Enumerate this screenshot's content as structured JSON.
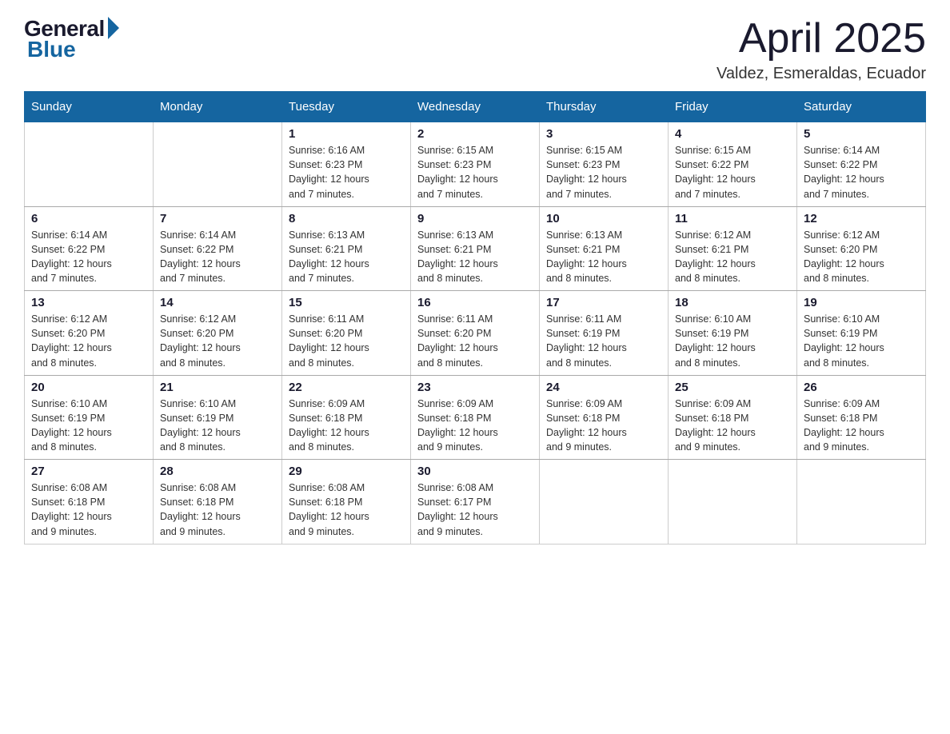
{
  "logo": {
    "general": "General",
    "blue": "Blue"
  },
  "title": "April 2025",
  "location": "Valdez, Esmeraldas, Ecuador",
  "days_header": [
    "Sunday",
    "Monday",
    "Tuesday",
    "Wednesday",
    "Thursday",
    "Friday",
    "Saturday"
  ],
  "weeks": [
    [
      {
        "day": "",
        "info": ""
      },
      {
        "day": "",
        "info": ""
      },
      {
        "day": "1",
        "info": "Sunrise: 6:16 AM\nSunset: 6:23 PM\nDaylight: 12 hours\nand 7 minutes."
      },
      {
        "day": "2",
        "info": "Sunrise: 6:15 AM\nSunset: 6:23 PM\nDaylight: 12 hours\nand 7 minutes."
      },
      {
        "day": "3",
        "info": "Sunrise: 6:15 AM\nSunset: 6:23 PM\nDaylight: 12 hours\nand 7 minutes."
      },
      {
        "day": "4",
        "info": "Sunrise: 6:15 AM\nSunset: 6:22 PM\nDaylight: 12 hours\nand 7 minutes."
      },
      {
        "day": "5",
        "info": "Sunrise: 6:14 AM\nSunset: 6:22 PM\nDaylight: 12 hours\nand 7 minutes."
      }
    ],
    [
      {
        "day": "6",
        "info": "Sunrise: 6:14 AM\nSunset: 6:22 PM\nDaylight: 12 hours\nand 7 minutes."
      },
      {
        "day": "7",
        "info": "Sunrise: 6:14 AM\nSunset: 6:22 PM\nDaylight: 12 hours\nand 7 minutes."
      },
      {
        "day": "8",
        "info": "Sunrise: 6:13 AM\nSunset: 6:21 PM\nDaylight: 12 hours\nand 7 minutes."
      },
      {
        "day": "9",
        "info": "Sunrise: 6:13 AM\nSunset: 6:21 PM\nDaylight: 12 hours\nand 8 minutes."
      },
      {
        "day": "10",
        "info": "Sunrise: 6:13 AM\nSunset: 6:21 PM\nDaylight: 12 hours\nand 8 minutes."
      },
      {
        "day": "11",
        "info": "Sunrise: 6:12 AM\nSunset: 6:21 PM\nDaylight: 12 hours\nand 8 minutes."
      },
      {
        "day": "12",
        "info": "Sunrise: 6:12 AM\nSunset: 6:20 PM\nDaylight: 12 hours\nand 8 minutes."
      }
    ],
    [
      {
        "day": "13",
        "info": "Sunrise: 6:12 AM\nSunset: 6:20 PM\nDaylight: 12 hours\nand 8 minutes."
      },
      {
        "day": "14",
        "info": "Sunrise: 6:12 AM\nSunset: 6:20 PM\nDaylight: 12 hours\nand 8 minutes."
      },
      {
        "day": "15",
        "info": "Sunrise: 6:11 AM\nSunset: 6:20 PM\nDaylight: 12 hours\nand 8 minutes."
      },
      {
        "day": "16",
        "info": "Sunrise: 6:11 AM\nSunset: 6:20 PM\nDaylight: 12 hours\nand 8 minutes."
      },
      {
        "day": "17",
        "info": "Sunrise: 6:11 AM\nSunset: 6:19 PM\nDaylight: 12 hours\nand 8 minutes."
      },
      {
        "day": "18",
        "info": "Sunrise: 6:10 AM\nSunset: 6:19 PM\nDaylight: 12 hours\nand 8 minutes."
      },
      {
        "day": "19",
        "info": "Sunrise: 6:10 AM\nSunset: 6:19 PM\nDaylight: 12 hours\nand 8 minutes."
      }
    ],
    [
      {
        "day": "20",
        "info": "Sunrise: 6:10 AM\nSunset: 6:19 PM\nDaylight: 12 hours\nand 8 minutes."
      },
      {
        "day": "21",
        "info": "Sunrise: 6:10 AM\nSunset: 6:19 PM\nDaylight: 12 hours\nand 8 minutes."
      },
      {
        "day": "22",
        "info": "Sunrise: 6:09 AM\nSunset: 6:18 PM\nDaylight: 12 hours\nand 8 minutes."
      },
      {
        "day": "23",
        "info": "Sunrise: 6:09 AM\nSunset: 6:18 PM\nDaylight: 12 hours\nand 9 minutes."
      },
      {
        "day": "24",
        "info": "Sunrise: 6:09 AM\nSunset: 6:18 PM\nDaylight: 12 hours\nand 9 minutes."
      },
      {
        "day": "25",
        "info": "Sunrise: 6:09 AM\nSunset: 6:18 PM\nDaylight: 12 hours\nand 9 minutes."
      },
      {
        "day": "26",
        "info": "Sunrise: 6:09 AM\nSunset: 6:18 PM\nDaylight: 12 hours\nand 9 minutes."
      }
    ],
    [
      {
        "day": "27",
        "info": "Sunrise: 6:08 AM\nSunset: 6:18 PM\nDaylight: 12 hours\nand 9 minutes."
      },
      {
        "day": "28",
        "info": "Sunrise: 6:08 AM\nSunset: 6:18 PM\nDaylight: 12 hours\nand 9 minutes."
      },
      {
        "day": "29",
        "info": "Sunrise: 6:08 AM\nSunset: 6:18 PM\nDaylight: 12 hours\nand 9 minutes."
      },
      {
        "day": "30",
        "info": "Sunrise: 6:08 AM\nSunset: 6:17 PM\nDaylight: 12 hours\nand 9 minutes."
      },
      {
        "day": "",
        "info": ""
      },
      {
        "day": "",
        "info": ""
      },
      {
        "day": "",
        "info": ""
      }
    ]
  ]
}
